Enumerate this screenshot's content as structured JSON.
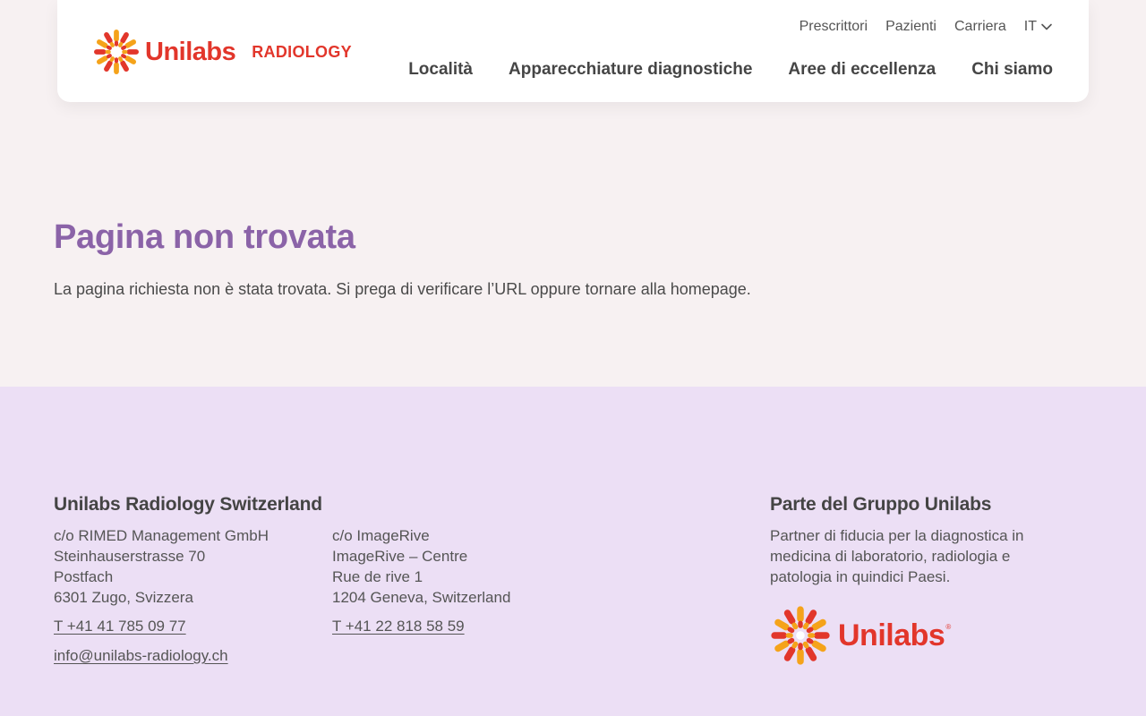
{
  "header": {
    "logo_word": "Unilabs",
    "logo_sub": "RADIOLOGY",
    "utility_nav": [
      "Prescrittori",
      "Pazienti",
      "Carriera"
    ],
    "language": "IT",
    "main_nav": [
      "Località",
      "Apparecchiature diagnostiche",
      "Aree di eccellenza",
      "Chi siamo"
    ]
  },
  "content": {
    "title": "Pagina non trovata",
    "message": "La pagina richiesta non è stata trovata. Si prega di verificare l’URL oppure tornare alla homepage."
  },
  "footer": {
    "left_title": "Unilabs Radiology Switzerland",
    "address1": [
      "c/o RIMED Management GmbH",
      "Steinhauserstrasse 70",
      "Postfach",
      "6301 Zugo, Svizzera"
    ],
    "phone1": "T +41 41 785 09 77",
    "email": "info@unilabs-radiology.ch",
    "address2": [
      "c/o ImageRive",
      "ImageRive – Centre",
      "Rue de rive 1",
      "1204 Geneva, Switzerland"
    ],
    "phone2": "T +41 22 818 58 59",
    "right_title": "Parte del Gruppo Unilabs",
    "right_text": "Partner di fiducia per la diagnostica in medicina di laboratorio, radiologia e patologia in quindici Paesi.",
    "group_logo_word": "Unilabs",
    "group_logo_reg": "®"
  },
  "colors": {
    "brand_red": "#e2362b",
    "brand_orange": "#f5a31a",
    "title_purple": "#8b63a8",
    "footer_bg": "#ecdff5",
    "page_bg": "#f7f1f2"
  },
  "icons": {
    "logo": "sunburst-logo-icon",
    "language_dropdown": "chevron-down-icon"
  }
}
